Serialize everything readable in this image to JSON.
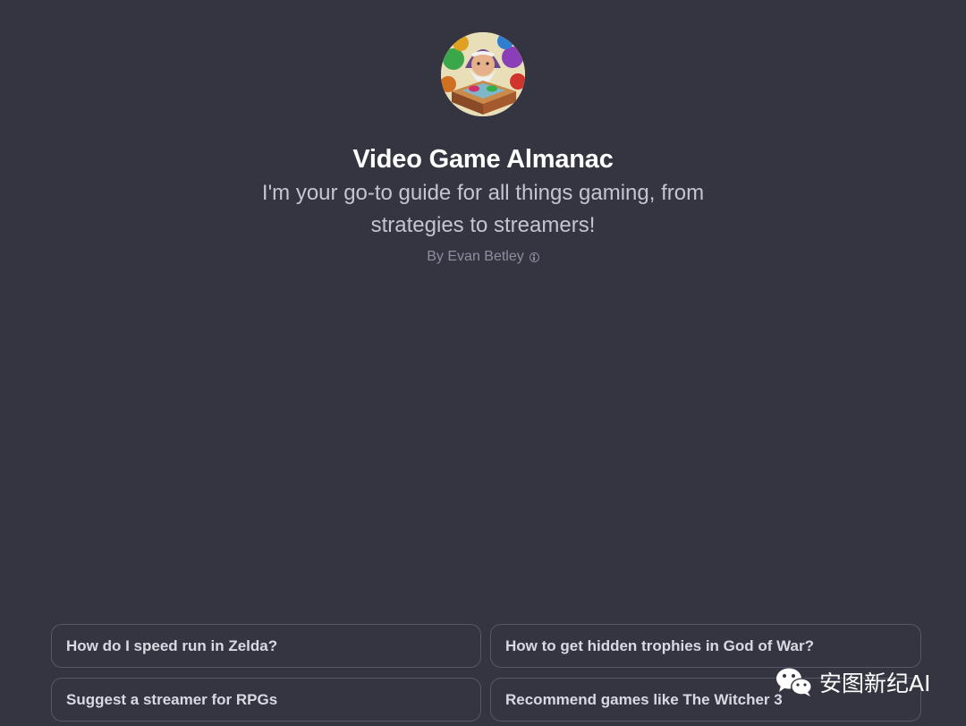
{
  "gpt": {
    "avatar_icon": "bearded-wizard-gamer-avatar",
    "name": "Video Game Almanac",
    "description": "I'm your go-to guide for all things gaming, from strategies to streamers!",
    "author": "By Evan Betley",
    "author_info_icon": "info-icon"
  },
  "suggestions": [
    "How do I speed run in Zelda?",
    "How to get hidden trophies in God of War?",
    "Suggest a streamer for RPGs",
    "Recommend games like The Witcher 3"
  ],
  "watermark": {
    "icon": "wechat-icon",
    "text": "安图新纪AI"
  },
  "colors": {
    "background": "#343541",
    "title": "#ffffff",
    "description": "#c5c5d2",
    "author": "#8e8ea0",
    "suggestion_border": "#565869",
    "suggestion_text": "#d9d9e3"
  }
}
